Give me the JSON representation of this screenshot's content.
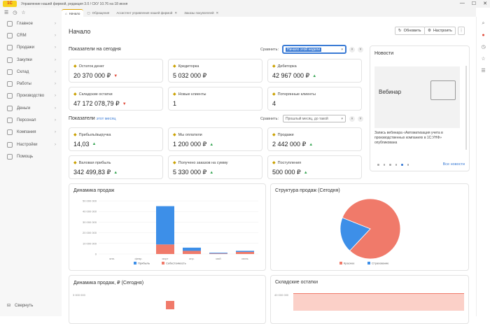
{
  "window": {
    "title": "Управление нашей фирмой, редакция 3.0 / СКУ 10.76 на 18 июня",
    "logo_text": "1С"
  },
  "tabs": [
    {
      "label": "Начало",
      "active": true
    },
    {
      "label": "Обращения"
    },
    {
      "label": "Ассистент управления нашей фирмой"
    },
    {
      "label": "Заказы покупателей"
    }
  ],
  "sidebar": {
    "items": [
      {
        "label": "Главное",
        "icon": "home-icon"
      },
      {
        "label": "CRM",
        "icon": "crm-icon"
      },
      {
        "label": "Продажи",
        "icon": "sales-icon"
      },
      {
        "label": "Закупки",
        "icon": "purchases-icon"
      },
      {
        "label": "Склад",
        "icon": "warehouse-icon"
      },
      {
        "label": "Работы",
        "icon": "works-icon"
      },
      {
        "label": "Производство",
        "icon": "production-icon"
      },
      {
        "label": "Деньги",
        "icon": "money-icon"
      },
      {
        "label": "Персонал",
        "icon": "staff-icon"
      },
      {
        "label": "Компания",
        "icon": "company-icon"
      },
      {
        "label": "Настройки",
        "icon": "settings-icon"
      },
      {
        "label": "Помощь",
        "icon": "help-icon"
      }
    ],
    "collapse_label": "Свернуть"
  },
  "main": {
    "title": "Начало",
    "refresh_label": "Обновить",
    "settings_label": "Настроить",
    "section1": {
      "title": "Показатели на сегодня",
      "compare_label": "Сравнить:",
      "compare_value": "Начало этой недели"
    },
    "section2": {
      "title": "Показатели",
      "period_link": "этот месяц",
      "compare_label": "Сравнить:",
      "compare_value": "Прошлый месяц, до такой"
    },
    "cards_today": [
      {
        "label": "Остаток денег",
        "value": "20 370 000 ₽",
        "trend": "down"
      },
      {
        "label": "Кредиторка",
        "value": "5 032 000 ₽",
        "trend": "none"
      },
      {
        "label": "Дебиторка",
        "value": "42 967 000 ₽",
        "trend": "up"
      },
      {
        "label": "Складские остатки",
        "value": "47 172 078,79 ₽",
        "trend": "down"
      },
      {
        "label": "Новые клиенты",
        "value": "1",
        "trend": "none"
      },
      {
        "label": "Потерянные клиенты",
        "value": "4",
        "trend": "none"
      }
    ],
    "cards_month": [
      {
        "label": "Прибыль/выручка",
        "value": "14,03",
        "trend": "up"
      },
      {
        "label": "Мы оплатили",
        "value": "1 200 000 ₽",
        "trend": "up"
      },
      {
        "label": "Продажи",
        "value": "2 442 000 ₽",
        "trend": "up"
      },
      {
        "label": "Валовая прибыль",
        "value": "342 499,83 ₽",
        "trend": "up"
      },
      {
        "label": "Получено заказов на сумму",
        "value": "5 330 000 ₽",
        "trend": "up"
      },
      {
        "label": "Поступления",
        "value": "500 000 ₽",
        "trend": "up"
      }
    ]
  },
  "news": {
    "title": "Новости",
    "image_caption": "Вебинар",
    "text": "Запись вебинара «Автоматизация учета в производственных компаниях в 1С:УНФ» опубликована",
    "all_link": "Все новости"
  },
  "panels": {
    "sales_dynamics_title": "Динамика продаж",
    "sales_structure_title": "Структура продаж (Сегодня)",
    "sales_dynamics_rub_title": "Динамика продаж, ₽ (Сегодня)",
    "stock_title": "Складские остатки",
    "bottom_left_tick": "3 000 000",
    "bottom_right_tick": "40 000 000"
  },
  "colors": {
    "blue": "#3d8fe8",
    "salmon": "#f07a6a",
    "accent": "#e0a300"
  },
  "chart_data": [
    {
      "type": "bar",
      "title": "Динамика продаж",
      "categories": [
        "янв.",
        "февр.",
        "март",
        "апр.",
        "май",
        "июнь"
      ],
      "yticks": [
        "0",
        "10 000 000",
        "20 000 000",
        "30 000 000",
        "40 000 000",
        "50 000 000"
      ],
      "ylim": [
        0,
        50000000
      ],
      "series": [
        {
          "name": "Прибыль",
          "color": "#3d8fe8",
          "values": [
            0,
            0,
            36000000,
            3000000,
            700000,
            1000000
          ]
        },
        {
          "name": "Себестоимость",
          "color": "#f07a6a",
          "values": [
            0,
            0,
            9000000,
            3000000,
            500000,
            2000000
          ]
        }
      ],
      "stacked": true
    },
    {
      "type": "pie",
      "title": "Структура продаж (Сегодня)",
      "slices": [
        {
          "name": "Красное",
          "color": "#f07a6a",
          "value": 81
        },
        {
          "name": "Страхование",
          "color": "#3d8fe8",
          "value": 19
        }
      ]
    }
  ]
}
